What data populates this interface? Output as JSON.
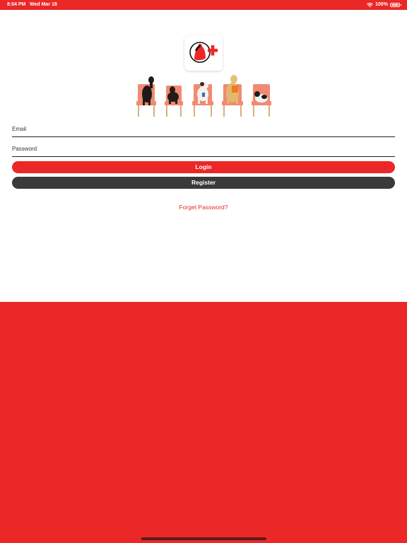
{
  "status_bar": {
    "time": "8:04 PM",
    "date": "Wed Mar 18",
    "battery": "100%",
    "icons": [
      "wifi-icon",
      "battery-icon"
    ]
  },
  "logo": {
    "icon": "pet-plus-logo"
  },
  "form": {
    "email_placeholder": "Email",
    "password_placeholder": "Password",
    "login_label": "Login",
    "register_label": "Register",
    "forgot_label": "Forget Password?"
  },
  "colors": {
    "brand_red": "#ec2727",
    "dark_button": "#3a3a3a",
    "chair": "#f18a73"
  }
}
